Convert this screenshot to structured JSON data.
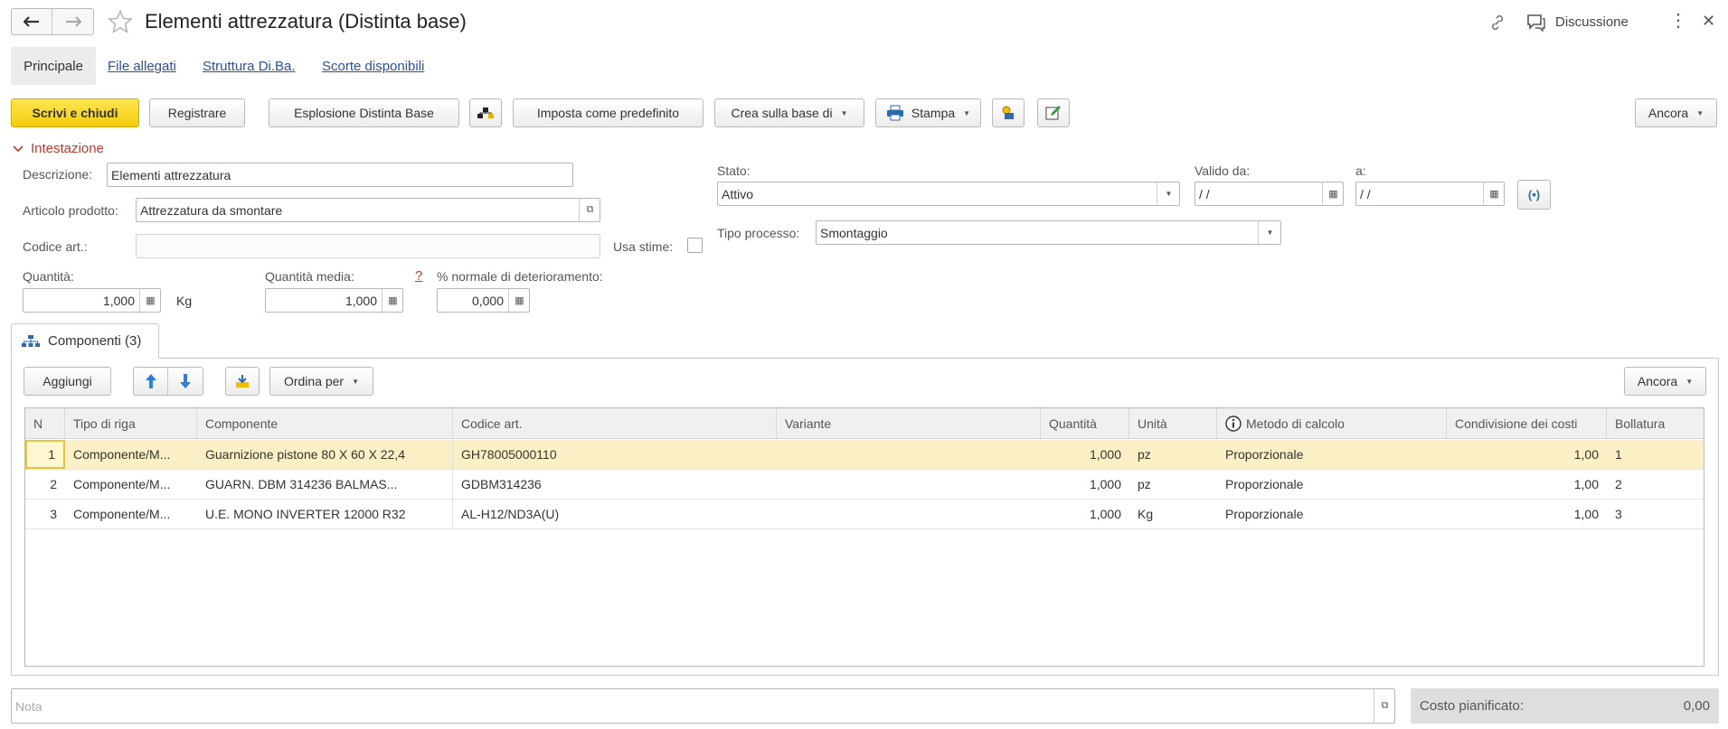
{
  "header": {
    "title": "Elementi attrezzatura (Distinta base)",
    "discussion_label": "Discussione"
  },
  "tabs": [
    "Principale",
    "File allegati",
    "Struttura Di.Ba.",
    "Scorte disponibili"
  ],
  "toolbar": {
    "save_close": "Scrivi e chiudi",
    "register": "Registrare",
    "explode": "Esplosione Distinta Base",
    "set_default": "Imposta come predefinito",
    "create_based": "Crea sulla base di",
    "print": "Stampa",
    "more": "Ancora"
  },
  "section": {
    "title": "Intestazione"
  },
  "form": {
    "descrizione_label": "Descrizione:",
    "descrizione_value": "Elementi attrezzatura",
    "articolo_label": "Articolo prodotto:",
    "articolo_value": "Attrezzatura da smontare",
    "codice_label": "Codice art.:",
    "codice_value": "",
    "usa_stime_label": "Usa stime:",
    "stato_label": "Stato:",
    "stato_value": "Attivo",
    "valido_da_label": "Valido da:",
    "valido_da_value": " /  /",
    "a_label": "a:",
    "a_value": " /  /",
    "tipo_processo_label": "Tipo processo:",
    "tipo_processo_value": "Smontaggio",
    "quantita_label": "Quantità:",
    "quantita_value": "1,000",
    "unit": "Kg",
    "quantita_media_label": "Quantità media:",
    "quantita_media_value": "1,000",
    "help_mark": "?",
    "deterioramento_label": "% normale di deterioramento:",
    "deterioramento_value": "0,000"
  },
  "components_tab": {
    "label": "Componenti (3)"
  },
  "components_toolbar": {
    "add": "Aggiungi",
    "sort": "Ordina per",
    "more": "Ancora"
  },
  "table": {
    "columns": [
      "N",
      "Tipo di riga",
      "Componente",
      "Codice art.",
      "Variante",
      "Quantità",
      "Unità",
      "Metodo di calcolo",
      "Condivisione dei costi",
      "Bollatura"
    ],
    "rows": [
      [
        "1",
        "Componente/M...",
        "Guarnizione pistone 80 X 60 X 22,4",
        "GH78005000110",
        "",
        "1,000",
        "pz",
        "Proporzionale",
        "1,00",
        "1"
      ],
      [
        "2",
        "Componente/M...",
        "GUARN. DBM 314236 BALMAS...",
        "GDBM314236",
        "",
        "1,000",
        "pz",
        "Proporzionale",
        "1,00",
        "2"
      ],
      [
        "3",
        "Componente/M...",
        "U.E. MONO INVERTER 12000 R32",
        "AL-H12/ND3A(U)",
        "",
        "1,000",
        "Kg",
        "Proporzionale",
        "1,00",
        "3"
      ]
    ]
  },
  "footer": {
    "nota_placeholder": "Nota",
    "costo_label": "Costo pianificato:",
    "costo_value": "0,00"
  },
  "colors": {
    "accent_yellow": "#f5d21a",
    "section_red": "#c0392b",
    "link_blue": "#2b4fa8",
    "selected_row": "#fbf0c5"
  }
}
